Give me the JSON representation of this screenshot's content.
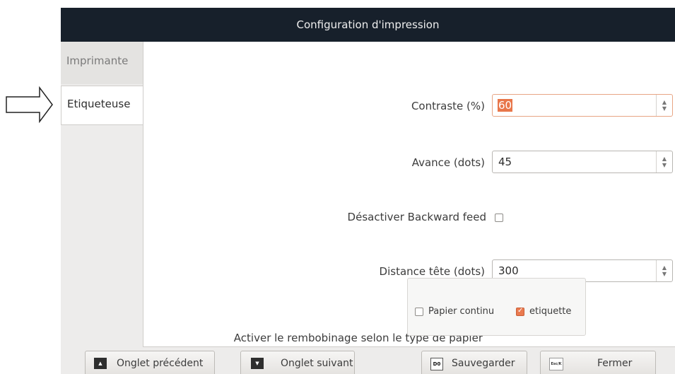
{
  "window": {
    "title": "Configuration d'impression"
  },
  "tabs": [
    {
      "label": "Imprimante",
      "active": false
    },
    {
      "label": "Etiqueteuse",
      "active": true
    }
  ],
  "form": {
    "contrast": {
      "label": "Contraste (%)",
      "value": "60"
    },
    "feed": {
      "label": "Avance (dots)",
      "value": "45"
    },
    "backward": {
      "label": "Désactiver Backward feed",
      "checked": false
    },
    "head_distance": {
      "label": "Distance tête (dots)",
      "value": "300"
    },
    "rewind": {
      "label": "Activer le rembobinage selon le type de papier",
      "continuous_label": "Papier continu",
      "continuous_checked": false,
      "label_option": "etiquette",
      "label_checked": true
    }
  },
  "buttons": {
    "prev": {
      "label": "Onglet précédent",
      "icon": "printer-up-icon"
    },
    "next": {
      "label": "Onglet suivant",
      "icon": "printer-down-icon"
    },
    "save": {
      "label": "Sauvegarder",
      "key": "D0"
    },
    "close": {
      "label": "Fermer",
      "key": "Esc/K"
    }
  },
  "colors": {
    "titlebar": "#17202b",
    "accent": "#e8764a"
  }
}
